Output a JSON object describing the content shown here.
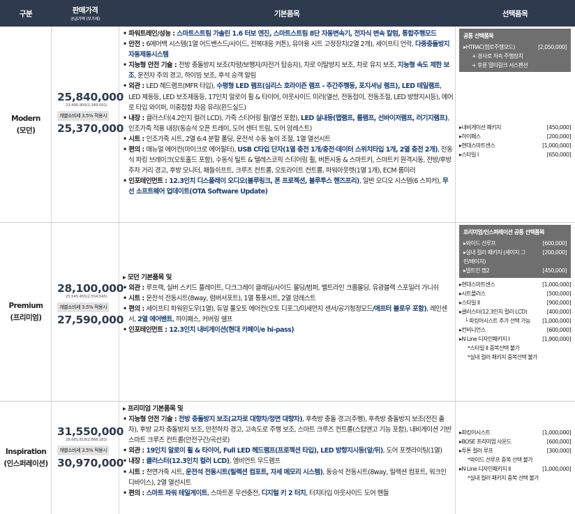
{
  "header": {
    "col_category": "구분",
    "col_price": "판매가격",
    "col_price_sub": "공급가액 (부가세)",
    "col_basic": "기본품목",
    "col_option": "선택품목"
  },
  "common": {
    "tax_label": "개별소비세 3.5% 적용시"
  },
  "modern": {
    "name": "Modern",
    "name_kr": "(모던)",
    "price": "25,840,000",
    "price_detail": "23,490,909(2,349,091)",
    "price_tax": "25,370,000",
    "basic": [
      [
        "b:파워트레인/성능 : ",
        "blu:스마트스트림 가솔린 1.6 터보 엔진, 스마트스트림 8단 자동변속기, 전자식 변속 칼럼, 통합주행모드"
      ],
      [
        "b:안전 : ",
        "6에어백 시스템(1열 어드밴스드/사이드, 전복대응 커튼), 유아용 시트 고정장치(2열 2개), 세이프티 언락, ",
        "blu:다중충돌방지 자동제동시스템"
      ],
      [
        "b:지능형 안전 기술 : ",
        "전방 충돌방지 보조(차량/보행자/자전거 탑승자), 차로 이탈방지 보조, 차로 유지 보조, ",
        "blu:지능형 속도 제한 보조",
        ", 운전자 주의 경고, 하이빔 보조, 후석 승객 알림"
      ],
      [
        "b:외관 : ",
        "LED 헤드램프(MFR 타입), ",
        "blu:수평형 LED 램프(심리스 호라이즌 램프 - 주간주행등, 포지셔닝 램프), LED 테일램프",
        ", LED 제동등, LED 보조제동등, 17인치 알로이 휠 & 타이어, 아웃사이드 미러(열선, 전동접이, 전동조절, LED 방향지시등), 에어로 타입 와이퍼, 이중접합 차음 유리(윈드실드)"
      ],
      [
        "b:내장 : ",
        "클러스터(4.2인치 컬러 LCD), 가죽 스티어링 휠(열선 포함), ",
        "blu:LED 실내등(맵램프, 룸램프, 선바이저램프, 러기지램프)",
        ", 인조가죽 적용 내장(동승석 오픈 트레이, 도어 센터 트림, 도어 암레스트)"
      ],
      [
        "b:시트 : ",
        "인조가죽 시트, 2열 6:4 분할 폴딩, 운전석 수동 높이 조절, 1열 열선시트"
      ],
      [
        "b:편의 : ",
        "매뉴얼 에어컨(마이크로 에어필터), ",
        "blu:USB C타입 단자(1열 충전 1개/충전·데이터 스위치타입 1개, 2열 충전 2개)",
        ", 전동식 파킹 브레이크(오토홀드 포함), 수동식 틸트 & 텔레스코픽 스티어링 휠, 버튼시동 & 스마트키, 스마트키 원격시동, 전방/후방 주차 거리 경고, 후방 모니터, 패들쉬프트, 크루즈 컨트롤, 오토라이트 컨트롤, 파워아웃렛(1열 1개), ECM 룸미러"
      ],
      [
        "b:인포테인먼트 : ",
        "blu:12.3인치 디스플레이 오디오(블루링크, 폰 프로젝션, 블루투스 핸즈프리)",
        ", 일반 오디오 시스템(6 스피커), ",
        "blu:무선 소프트웨어 업데이트(OTA Software Update)"
      ]
    ],
    "option_box": {
      "title": "공통 선택품목",
      "item": "HTRAC(험로주행모드)",
      "price": "[2,050,000]",
      "subs": [
        "+ 경사로 저속 주행장치",
        "+ 후륜 멀티링크 서스팬션"
      ]
    },
    "options": [
      {
        "label": "내비게이션 패키지",
        "price": "[450,000]"
      },
      {
        "label": "하이패스",
        "price": "[200,000]"
      },
      {
        "label": "현대스마트센스",
        "price": "[1,000,000]"
      },
      {
        "label": "스타일 I",
        "price": "[650,000]"
      }
    ]
  },
  "premium": {
    "name": "Premium",
    "name_kr": "(프리미엄)",
    "price": "28,100,000",
    "price_detail": "25,545,455(2,554,545)",
    "price_tax": "27,590,000",
    "basic": [
      [
        "b:▸ 모던 기본품목 및"
      ],
      [
        "b:외관 : ",
        "루프랙, 실버 스키드 플레이트, 다크그레이 클래딩/사이드 몰딩/범퍼, 벨트라인 크롬몰딩, 유광블랙 스포일러 가니쉬"
      ],
      [
        "b:시트 : ",
        "운전석 전동시트(8way, 럼버서포트), 1열 통풍시트, 2열 암레스트"
      ],
      [
        "b:편의 : ",
        "세이프티 파워윈도우(1열), 듀얼 풀오토 에어컨(오토 디포그/미세먼지 센서/공기청정모드/",
        "blu:애프터 블로우 포함)",
        ", 레인센서, ",
        "blu:2열 에어벤트",
        ", 하이패스, 커버링 쉘프"
      ],
      [
        "b:인포테인먼트 : ",
        "blu:12.3인치 내비게이션(현대 카페이/e hi-pass)"
      ]
    ],
    "option_box": {
      "title": "프리미엄/인스퍼레이션 공통 선택품목",
      "items": [
        {
          "label": "와이드 선루프",
          "price": "[600,000]"
        },
        {
          "label": "실내 컬러 패키지 (세이지 그린/베이지)",
          "price": "[200,000]"
        },
        {
          "label": "빌트인 캠2",
          "price": "[450,000]"
        }
      ]
    },
    "options": [
      {
        "label": "현대스마트센스",
        "price": "[1,000,000]"
      },
      {
        "label": "시트플러스",
        "price": "[500,000]"
      },
      {
        "label": "스타일 II",
        "price": "[900,000]"
      },
      {
        "label": "클러스터(12.3인치 컬러 LCD)",
        "price": "[400,000]"
      },
      {
        "label": "└ 파킹어시스트 추가 선택 가능",
        "price": "[1,000,000]"
      },
      {
        "label": "컨비니언스",
        "price": "[600,000]"
      },
      {
        "label": "N Line 디자인패키지 I",
        "price": "[1,900,000]"
      }
    ],
    "option_notes": [
      "*스타일 II 중복선택 불가",
      "*실내 컬러 패키지 중복선택 불가"
    ]
  },
  "inspiration": {
    "name": "Inspiration",
    "name_kr": "(인스퍼레이션)",
    "price": "31,550,000",
    "price_detail": "28,681,818(2,868,182)",
    "price_tax": "30,970,000",
    "basic": [
      [
        "b:▸ 프리미엄 기본품목 및"
      ],
      [
        "b:지능형 안전 기술 : ",
        "blu:전방 충돌방지 보조(교차로 대향차/정면 대향차)",
        ", 후측방 충돌 경고(주행), 후측방 충돌방지 보조(전진 출차), 후방 교차 충돌방지 보조, 안전하차 경고, 고속도로 주행 보조, 스마트 크루즈 컨트롤(스탑앤고 기능 포함), 내비게이션 기반 스마트 크루즈 컨트롤(안전구간/곡선로)"
      ],
      [
        "b:외관 : ",
        "blu:19인치 알로이 휠 & 타이어, Full LED 헤드램프(프로젝션 타입), LED 방향지시등(앞/뒤)",
        ", 도어 포켓라이팅(1열)"
      ],
      [
        "b:내장 : ",
        "blu:클러스터(12.3인치 컬러 LCD)",
        ", 앰비언트 무드램프"
      ],
      [
        "b:시트 : ",
        "천연가죽 시트, ",
        "blu:운전석 전동시트(릴렉션 컴포트, 자세 메모리 시스템)",
        ", 동승석 전동시트(8way, 릴렉션 컴포트, 워크인 디바이스), 2열 열선시트"
      ],
      [
        "b:편의 : ",
        "blu:스마트 파워 테일게이트",
        ", 스마트폰 무선충전, ",
        "blu:디지털 키 2 터치",
        ", 터치타입 아웃사이드 도어 핸들"
      ]
    ],
    "options": [
      {
        "label": "파킹어시스트",
        "price": "[1,000,000]"
      },
      {
        "label": "BOSE 프리미엄 사운드",
        "price": "[600,000]"
      },
      {
        "label": "투톤 컬러 루프",
        "price": "[300,000]"
      }
    ],
    "note1": "*와이드 선루프 중복 선택 불가",
    "option2": {
      "label": "N Line 디자인패키지 II",
      "price": "[1,000,000]"
    },
    "note2": "*실내 컬러 패키지 중복 선택 불가"
  }
}
